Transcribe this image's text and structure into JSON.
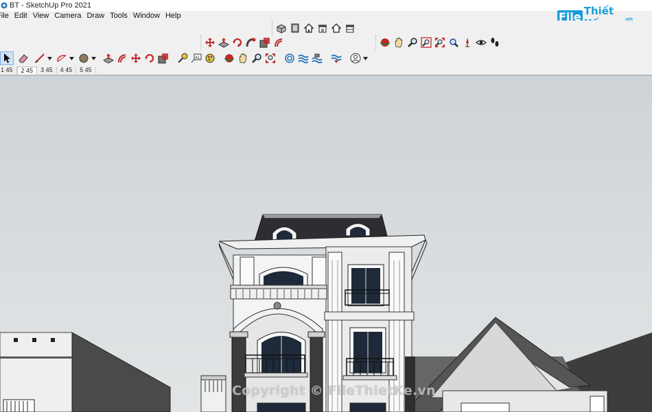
{
  "window": {
    "title": "BT - SketchUp Pro 2021"
  },
  "menubar": {
    "items": [
      "File",
      "Edit",
      "View",
      "Camera",
      "Draw",
      "Tools",
      "Window",
      "Help"
    ]
  },
  "scene_tabs": {
    "items": [
      "1 45",
      "2 45",
      "3 45",
      "4 45",
      "5 45"
    ],
    "active_index": 1
  },
  "branding": {
    "logo_file": "File",
    "logo_rest": "Thiết Kế",
    "logo_suffix": ".vn",
    "watermark": "Copyright © FileThietKe.vn"
  },
  "colors": {
    "accent": "#1a9ed8",
    "sky_top": "#cdd3d6",
    "sky_bottom": "#e2e5e6",
    "icon_red": "#c0282a"
  },
  "toolbars": {
    "views": [
      "iso-view-icon",
      "top-view-icon",
      "front-view-icon",
      "right-view-icon",
      "back-view-icon",
      "left-view-icon"
    ],
    "edit": [
      "move-icon",
      "push-pull-icon",
      "rotate-icon",
      "follow-me-icon",
      "scale-icon",
      "offset-icon"
    ],
    "camera": [
      "orbit-icon",
      "pan-icon",
      "zoom-icon",
      "zoom-window-icon",
      "zoom-extents-icon",
      "previous-view-icon",
      "position-camera-icon",
      "look-around-icon",
      "walk-icon"
    ],
    "main": [
      "select-icon",
      "eraser-icon",
      "line-icon",
      "arc-icon",
      "paint-bucket-icon",
      "push-pull-icon",
      "follow-me-icon",
      "move-icon",
      "rotate-icon",
      "scale-icon",
      "tape-measure-icon",
      "text-icon",
      "paint-icon",
      "orbit-icon",
      "pan-icon",
      "zoom-icon",
      "zoom-extents-icon",
      "sandbox-icon",
      "sandbox-smoove-icon",
      "sandbox-stamp-icon",
      "sandbox-drape-icon",
      "account-icon"
    ]
  }
}
